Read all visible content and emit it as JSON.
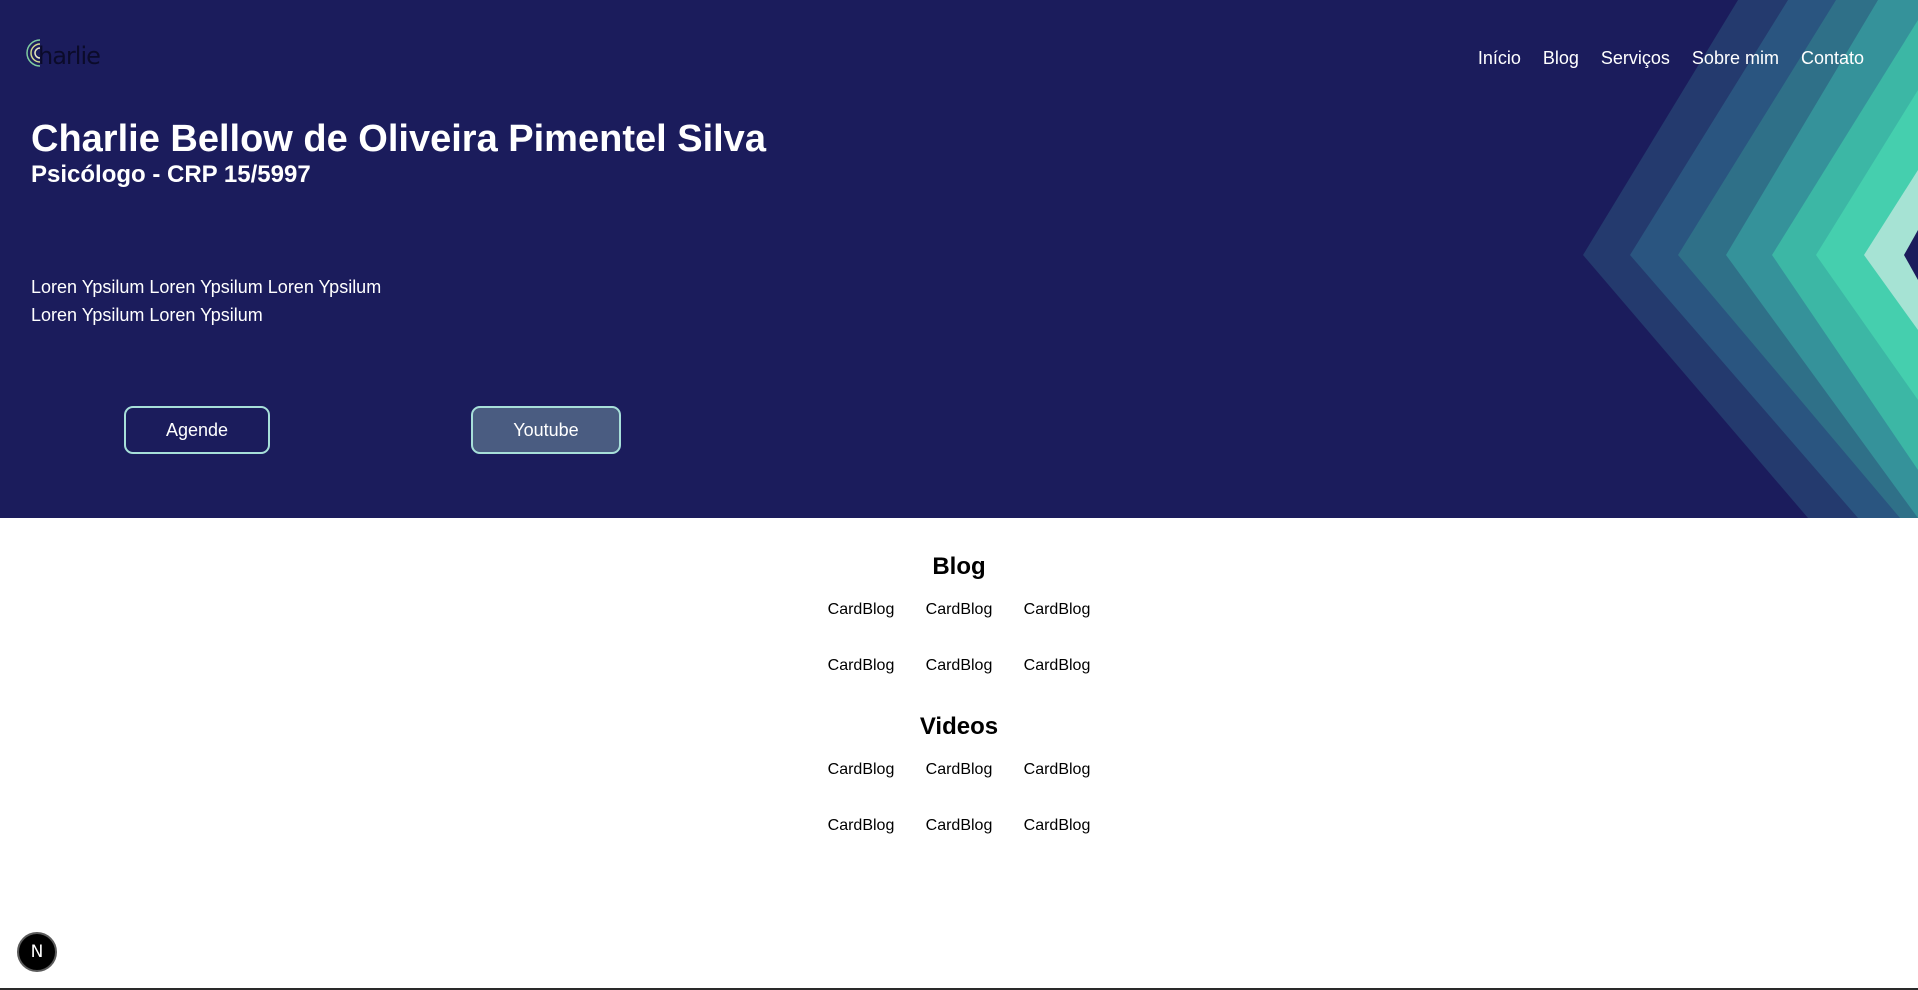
{
  "logo": {
    "text": "harlie"
  },
  "nav": {
    "items": [
      "Início",
      "Blog",
      "Serviços",
      "Sobre mim",
      "Contato"
    ]
  },
  "hero": {
    "title": "Charlie Bellow de Oliveira Pimentel Silva",
    "subtitle": "Psicólogo - CRP 15/5997",
    "intro_line1": "Loren Ypsilum Loren Ypsilum Loren Ypsilum",
    "intro_line2": "Loren Ypsilum Loren Ypsilum",
    "button_agende": "Agende",
    "button_youtube": "Youtube"
  },
  "blog": {
    "title": "Blog",
    "cards": [
      "CardBlog",
      "CardBlog",
      "CardBlog",
      "CardBlog",
      "CardBlog",
      "CardBlog"
    ]
  },
  "videos": {
    "title": "Videos",
    "cards": [
      "CardBlog",
      "CardBlog",
      "CardBlog",
      "CardBlog",
      "CardBlog",
      "CardBlog"
    ]
  },
  "fab": {
    "label": "N"
  },
  "colors": {
    "hero_bg": "#1b1c5c",
    "accent": "#3fc9a9",
    "button_border": "#a7dfd9"
  }
}
